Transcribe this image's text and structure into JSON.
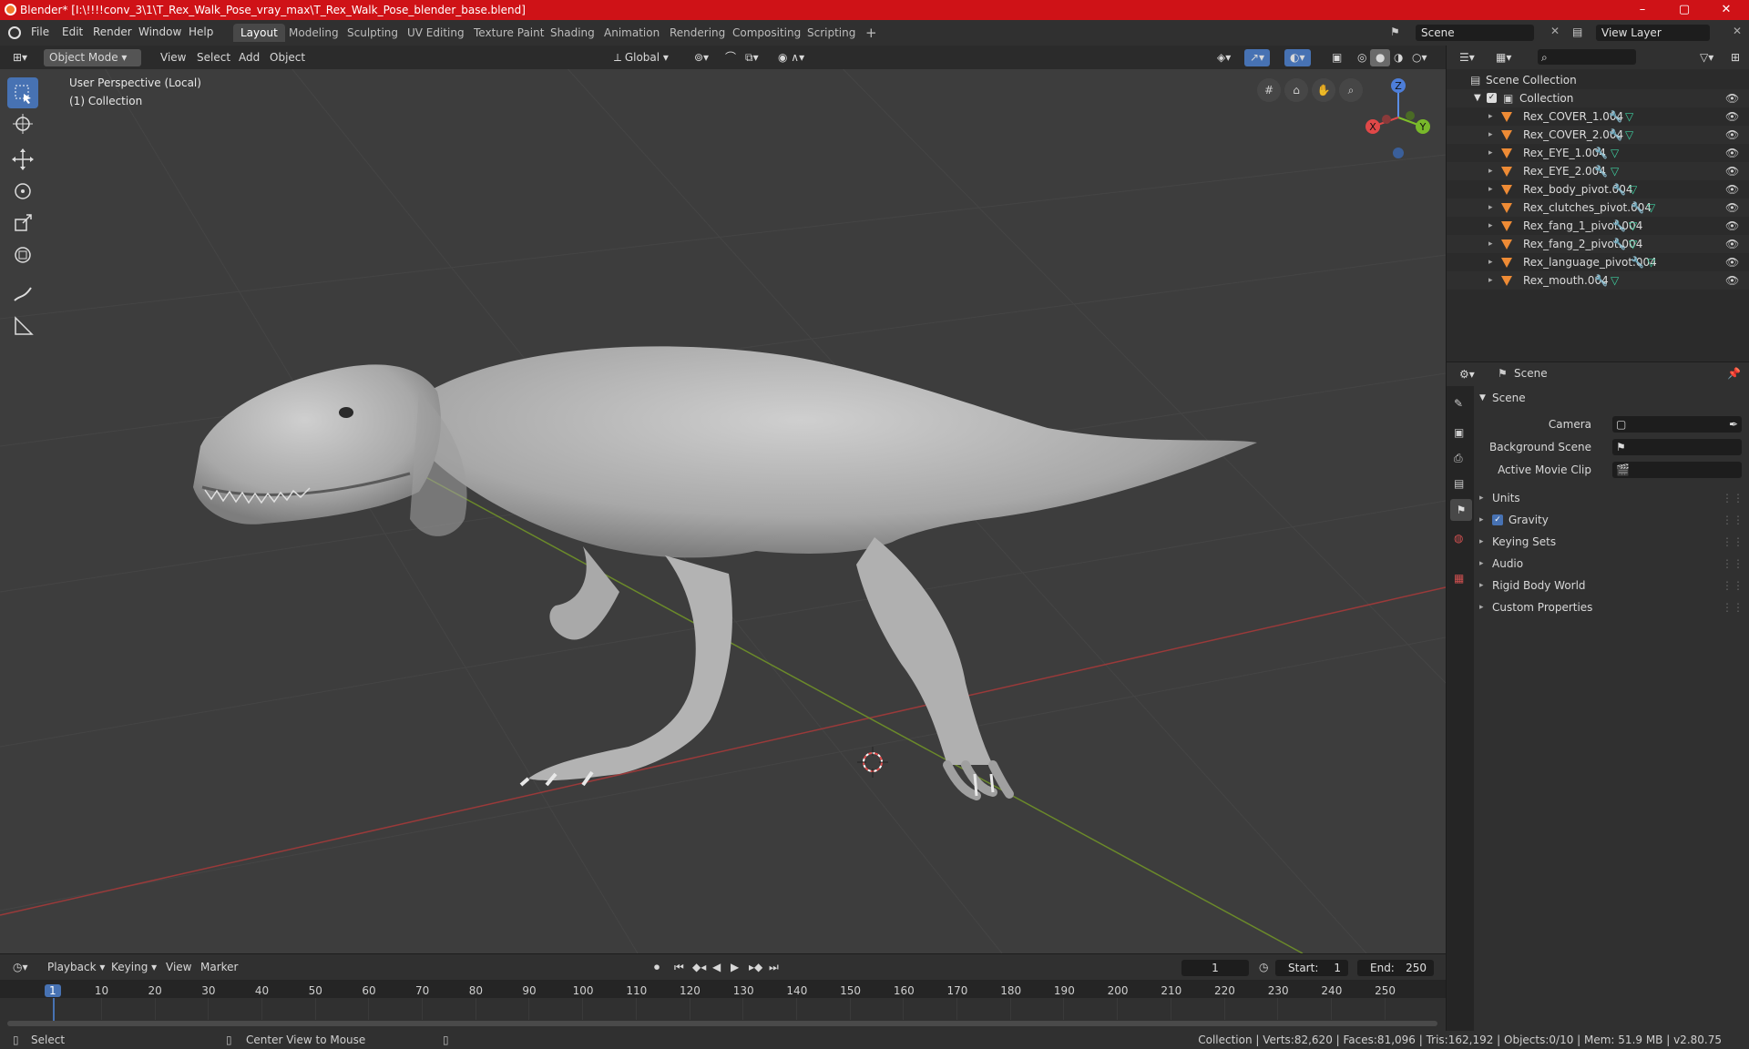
{
  "window": {
    "title": "Blender* [I:\\!!!!conv_3\\1\\T_Rex_Walk_Pose_vray_max\\T_Rex_Walk_Pose_blender_base.blend]",
    "min": "–",
    "max": "▢",
    "close": "✕"
  },
  "menu": [
    "File",
    "Edit",
    "Render",
    "Window",
    "Help"
  ],
  "workspaces": [
    "Layout",
    "Modeling",
    "Sculpting",
    "UV Editing",
    "Texture Paint",
    "Shading",
    "Animation",
    "Rendering",
    "Compositing",
    "Scripting"
  ],
  "workspace_add": "+",
  "scene_field": "Scene",
  "view_layer_field": "View Layer",
  "viewport": {
    "mode": "Object Mode",
    "menus": [
      "View",
      "Select",
      "Add",
      "Object"
    ],
    "orientation": "Global",
    "overlay_line1": "User Perspective (Local)",
    "overlay_line2": "(1) Collection",
    "gizmo": {
      "z": "Z",
      "y": "Y",
      "x": "X"
    }
  },
  "outliner": {
    "root": "Scene Collection",
    "collection": "Collection",
    "items": [
      "Rex_COVER_1.004",
      "Rex_COVER_2.004",
      "Rex_EYE_1.004",
      "Rex_EYE_2.004",
      "Rex_body_pivot.004",
      "Rex_clutches_pivot.004",
      "Rex_fang_1_pivot.004",
      "Rex_fang_2_pivot.004",
      "Rex_language_pivot.004",
      "Rex_mouth.004"
    ]
  },
  "properties": {
    "header": "Scene",
    "panel": "Scene",
    "camera_label": "Camera",
    "bg_scene_label": "Background Scene",
    "movie_clip_label": "Active Movie Clip",
    "sections": [
      "Units",
      "Gravity",
      "Keying Sets",
      "Audio",
      "Rigid Body World",
      "Custom Properties"
    ]
  },
  "timeline": {
    "menus": [
      "Playback",
      "Keying",
      "View",
      "Marker"
    ],
    "current_frame": "1",
    "start_label": "Start:",
    "start": "1",
    "end_label": "End:",
    "end": "250",
    "ticks": [
      "1",
      "10",
      "20",
      "30",
      "40",
      "50",
      "60",
      "70",
      "80",
      "90",
      "100",
      "110",
      "120",
      "130",
      "140",
      "150",
      "160",
      "170",
      "180",
      "190",
      "200",
      "210",
      "220",
      "230",
      "240",
      "250"
    ]
  },
  "status": {
    "left": "Select",
    "mid": "Center View to Mouse",
    "right": "Collection | Verts:82,620 | Faces:81,096 | Tris:162,192 | Objects:0/10 | Mem: 51.9 MB | v2.80.75"
  }
}
